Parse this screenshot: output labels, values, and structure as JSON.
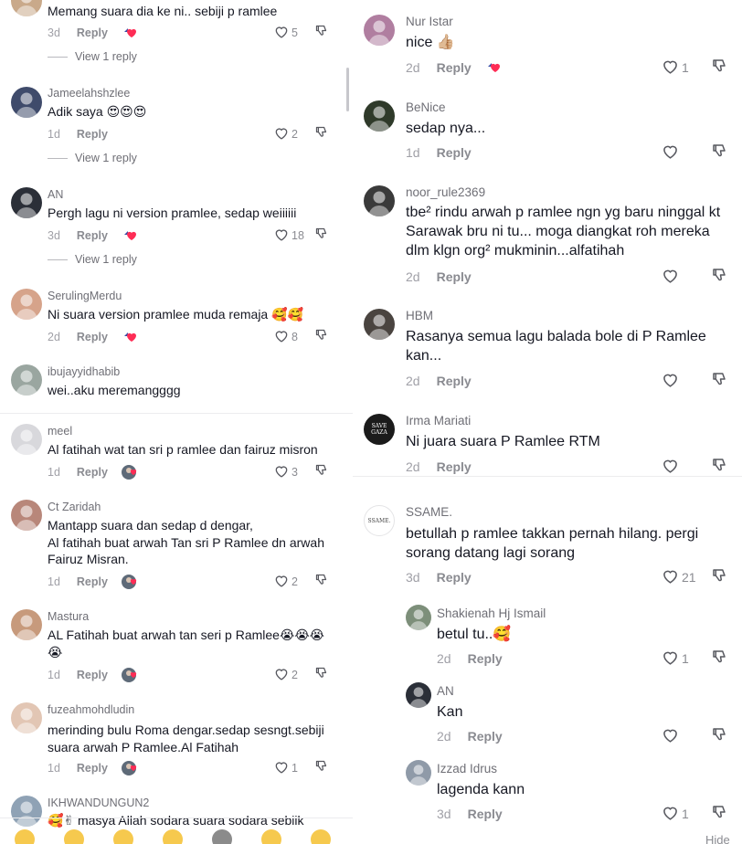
{
  "left_comments": [
    {
      "user": "",
      "text": "Memang suara dia ke ni.. sebiji p ramlee",
      "time": "3d",
      "reply": "Reply",
      "likes": "5",
      "view_replies": "View 1 reply",
      "avatar_color": "#c9a98a",
      "badge": "heart"
    },
    {
      "user": "Jameelahshzlee",
      "text": "Adik saya 😍😍😍",
      "time": "1d",
      "reply": "Reply",
      "likes": "2",
      "view_replies": "View 1 reply",
      "avatar_color": "#3f4b6b"
    },
    {
      "user": "AN",
      "text": "Pergh lagu ni version pramlee, sedap weiiiiii",
      "time": "3d",
      "reply": "Reply",
      "likes": "18",
      "view_replies": "View 1 reply",
      "avatar_color": "#2b2f38",
      "badge": "heart"
    },
    {
      "user": "SerulingMerdu",
      "text": "Ni suara version pramlee muda remaja 🥰🥰",
      "time": "2d",
      "reply": "Reply",
      "likes": "8",
      "avatar_color": "#d6a38a",
      "badge": "heart"
    },
    {
      "user": "ibujayyidhabib",
      "text": "wei..aku meremangggg",
      "avatar_color": "#9aa6a0"
    },
    {
      "user": "meel",
      "text": "Al fatihah wat tan sri p ramlee dan fairuz misron",
      "time": "1d",
      "reply": "Reply",
      "likes": "3",
      "avatar_color": "#d8d8dc",
      "badge": "avatar"
    },
    {
      "user": "Ct Zaridah",
      "text": "Mantapp suara dan sedap d dengar,\nAl fatihah buat arwah Tan sri P Ramlee dn arwah\nFairuz Misran.",
      "time": "1d",
      "reply": "Reply",
      "likes": "2",
      "avatar_color": "#b8877a",
      "badge": "avatar"
    },
    {
      "user": "Mastura",
      "text": "AL Fatihah buat arwah tan seri p Ramlee😭😭😭\n😭",
      "time": "1d",
      "reply": "Reply",
      "likes": "2",
      "avatar_color": "#c79a7c",
      "badge": "avatar"
    },
    {
      "user": "fuzeahmohdludin",
      "text": "merinding bulu Roma dengar.sedap sesngt.sebiji\nsuara arwah P Ramlee.Al Fatihah",
      "time": "1d",
      "reply": "Reply",
      "likes": "1",
      "avatar_color": "#e2c6b4",
      "badge": "avatar"
    },
    {
      "user": "IKHWANDUNGUN2",
      "text": "🥰✌ masya Allah sodara suara sodara sebiik",
      "avatar_color": "#8fa2b5"
    }
  ],
  "right_comments": [
    {
      "user": "Nur Istar",
      "text": "nice 👍🏼",
      "time": "2d",
      "reply": "Reply",
      "likes": "1",
      "avatar_color": "#b07ea0",
      "badge": "heart"
    },
    {
      "user": "BeNice",
      "text": "sedap nya...",
      "time": "1d",
      "reply": "Reply",
      "likes": "",
      "avatar_color": "#2f3a2a"
    },
    {
      "user": "noor_rule2369",
      "text": "tbe² rindu arwah p ramlee ngn yg baru ninggal kt\nSarawak bru ni tu... moga diangkat roh mereka\ndlm klgn org² mukminin...alfatihah",
      "time": "2d",
      "reply": "Reply",
      "likes": "",
      "avatar_color": "#3a3a3a"
    },
    {
      "user": "HBM",
      "text": "Rasanya semua lagu balada bole di P Ramlee\nkan...",
      "time": "2d",
      "reply": "Reply",
      "likes": "",
      "avatar_color": "#4a4440"
    },
    {
      "user": "Irma Mariati",
      "text": "Ni juara suara P Ramlee RTM",
      "time": "2d",
      "reply": "Reply",
      "likes": "",
      "avatar_color": "#1b1b1b",
      "avatar_label": "SAVE GAZA"
    },
    {
      "user": "SSAME.",
      "text": "betullah p ramlee takkan pernah hilang. pergi\nsorang datang lagi sorang",
      "time": "3d",
      "reply": "Reply",
      "likes": "21",
      "avatar_color": "#ffffff",
      "avatar_label": "SSAME."
    },
    {
      "user": "Shakienah Hj Ismail",
      "text": "betul tu..🥰",
      "time": "2d",
      "reply": "Reply",
      "likes": "1",
      "avatar_color": "#7d8f7a"
    },
    {
      "user": "AN",
      "text": "Kan",
      "time": "2d",
      "reply": "Reply",
      "likes": "",
      "avatar_color": "#2b2f38"
    },
    {
      "user": "Izzad Idrus",
      "text": "lagenda kann",
      "time": "3d",
      "reply": "Reply",
      "likes": "1",
      "avatar_color": "#8f9aa8"
    }
  ],
  "footer": {
    "hide_label": "Hide"
  },
  "colors": {
    "text": "#161823",
    "muted": "#8a8b91",
    "divider": "#ececee"
  }
}
